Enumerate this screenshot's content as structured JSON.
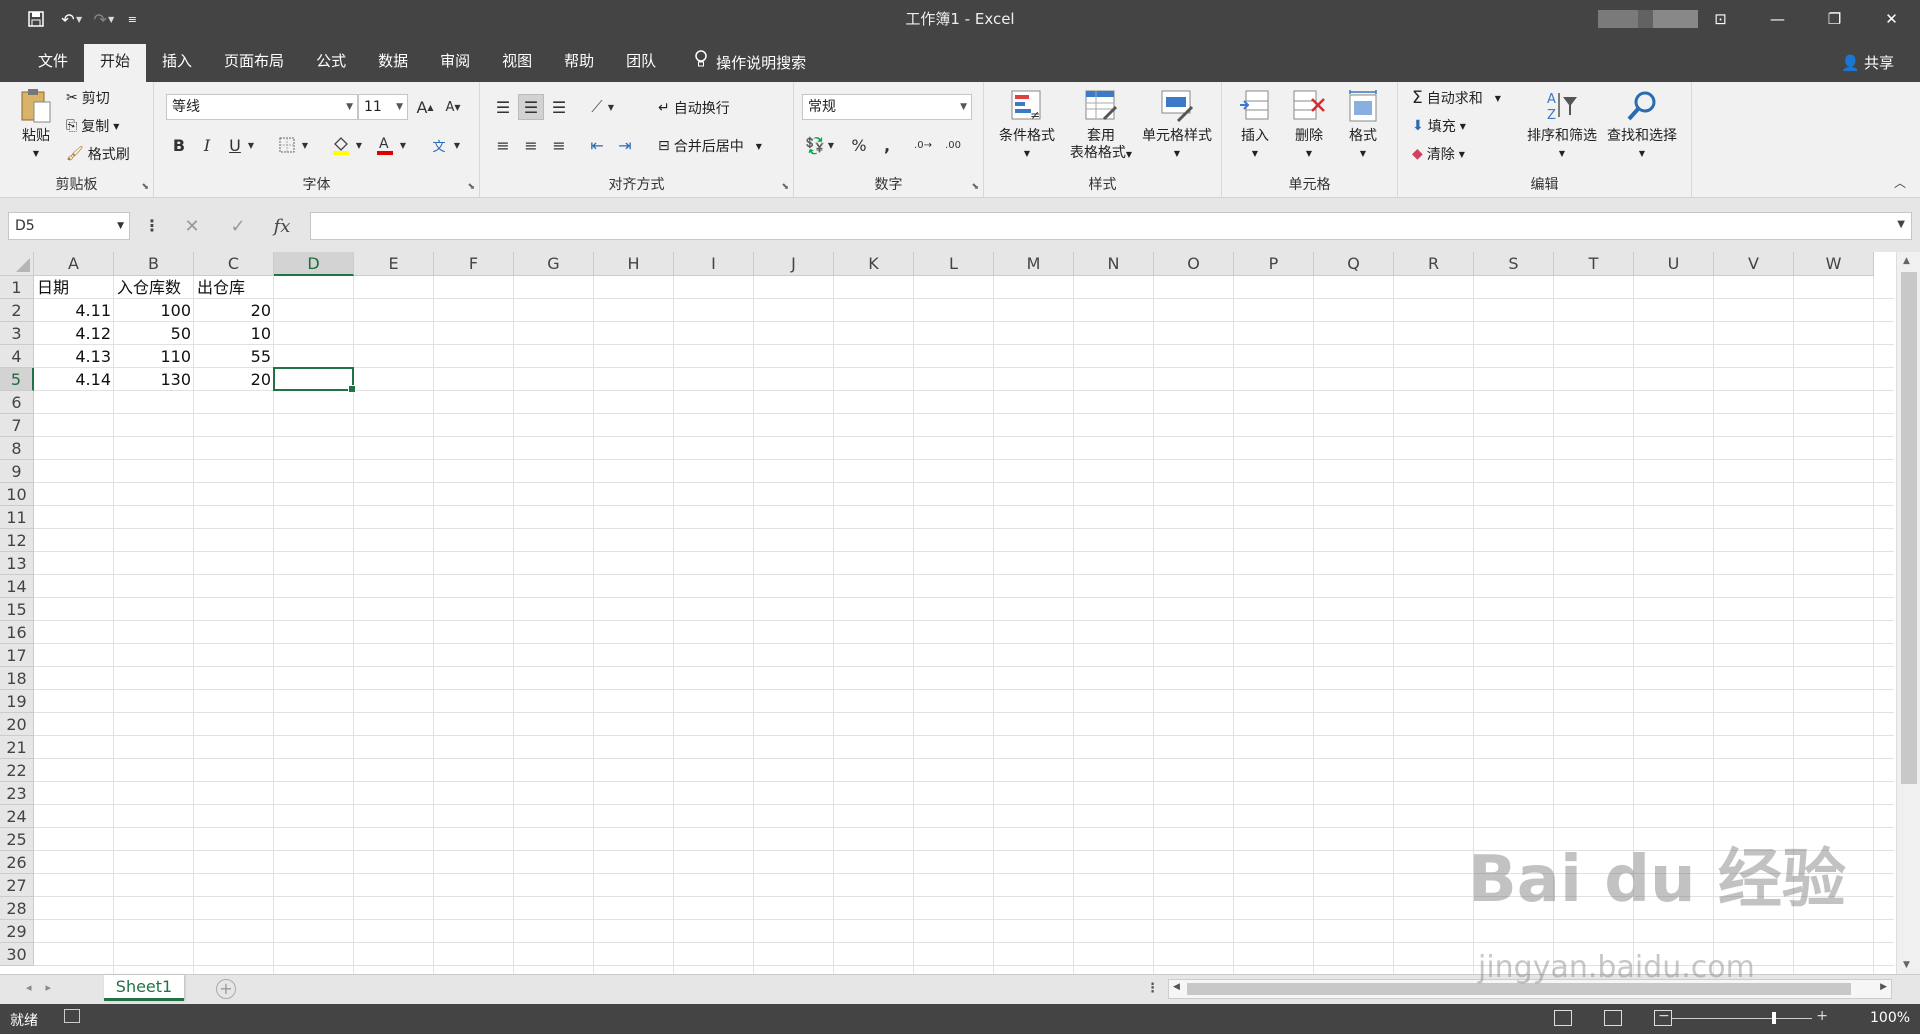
{
  "window": {
    "title": "工作簿1  -  Excel"
  },
  "tabs": [
    "文件",
    "开始",
    "插入",
    "页面布局",
    "公式",
    "数据",
    "审阅",
    "视图",
    "帮助",
    "团队"
  ],
  "tellme": "操作说明搜索",
  "share": "共享",
  "clipboard": {
    "paste": "粘贴",
    "cut": "剪切",
    "copy": "复制",
    "format_painter": "格式刷",
    "label": "剪贴板"
  },
  "font": {
    "name": "等线",
    "size": "11",
    "label": "字体",
    "bold": "B",
    "italic": "I",
    "underline": "U"
  },
  "alignment": {
    "wrap": "自动换行",
    "merge": "合并后居中",
    "label": "对齐方式"
  },
  "number": {
    "format": "常规",
    "label": "数字",
    "percent": "%",
    "comma": ","
  },
  "styles": {
    "conditional": "条件格式",
    "table1": "套用",
    "table2": "表格格式",
    "cell_styles": "单元格样式",
    "label": "样式"
  },
  "cells": {
    "insert": "插入",
    "delete": "删除",
    "format": "格式",
    "label": "单元格"
  },
  "editing": {
    "autosum": "自动求和",
    "fill": "填充",
    "clear": "清除",
    "sort": "排序和筛选",
    "find": "查找和选择",
    "label": "编辑"
  },
  "namebox": "D5",
  "columns": [
    "A",
    "B",
    "C",
    "D",
    "E",
    "F",
    "G",
    "H",
    "I",
    "J",
    "K",
    "L",
    "M",
    "N",
    "O",
    "P",
    "Q",
    "R",
    "S",
    "T",
    "U",
    "V",
    "W"
  ],
  "rows": [
    "1",
    "2",
    "3",
    "4",
    "5",
    "6",
    "7",
    "8",
    "9",
    "10",
    "11",
    "12",
    "13",
    "14",
    "15",
    "16",
    "17",
    "18",
    "19",
    "20",
    "21",
    "22",
    "23",
    "24",
    "25",
    "26",
    "27",
    "28",
    "29",
    "30"
  ],
  "cells_data": {
    "A1": "日期",
    "B1": "入仓库数",
    "C1": "出仓库",
    "A2": "4.11",
    "B2": "100",
    "C2": "20",
    "A3": "4.12",
    "B3": "50",
    "C3": "10",
    "A4": "4.13",
    "B4": "110",
    "C4": "55",
    "A5": "4.14",
    "B5": "130",
    "C5": "20"
  },
  "sheet": "Sheet1",
  "status": {
    "ready": "就绪",
    "zoom": "100%"
  },
  "watermark": {
    "brand": "Bai du 经验",
    "url": "jingyan.baidu.com"
  },
  "colors": {
    "accent": "#217346",
    "chrome": "#444444",
    "ribbon": "#f1f1f1"
  }
}
